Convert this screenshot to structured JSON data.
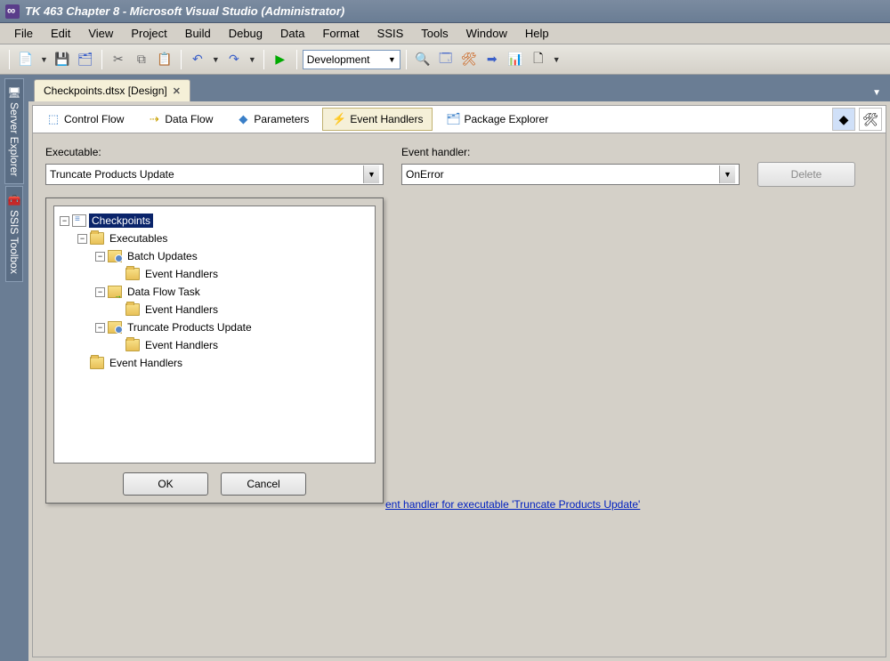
{
  "title": "TK 463 Chapter 8 - Microsoft Visual Studio (Administrator)",
  "menu": [
    "File",
    "Edit",
    "View",
    "Project",
    "Build",
    "Debug",
    "Data",
    "Format",
    "SSIS",
    "Tools",
    "Window",
    "Help"
  ],
  "toolbar": {
    "config": "Development"
  },
  "side_tabs": [
    "Server Explorer",
    "SSIS Toolbox"
  ],
  "doc_tab": {
    "label": "Checkpoints.dtsx [Design]"
  },
  "inner_tabs": {
    "control_flow": "Control Flow",
    "data_flow": "Data Flow",
    "parameters": "Parameters",
    "event_handlers": "Event Handlers",
    "package_explorer": "Package Explorer"
  },
  "fields": {
    "executable_label": "Executable:",
    "executable_value": "Truncate Products Update",
    "handler_label": "Event handler:",
    "handler_value": "OnError",
    "delete": "Delete"
  },
  "tree": {
    "root": "Checkpoints",
    "executables": "Executables",
    "batch_updates": "Batch Updates",
    "event_handlers": "Event Handlers",
    "data_flow_task": "Data Flow Task",
    "truncate": "Truncate Products Update"
  },
  "popup": {
    "ok": "OK",
    "cancel": "Cancel"
  },
  "hint_link": "ent handler for executable 'Truncate Products Update'"
}
